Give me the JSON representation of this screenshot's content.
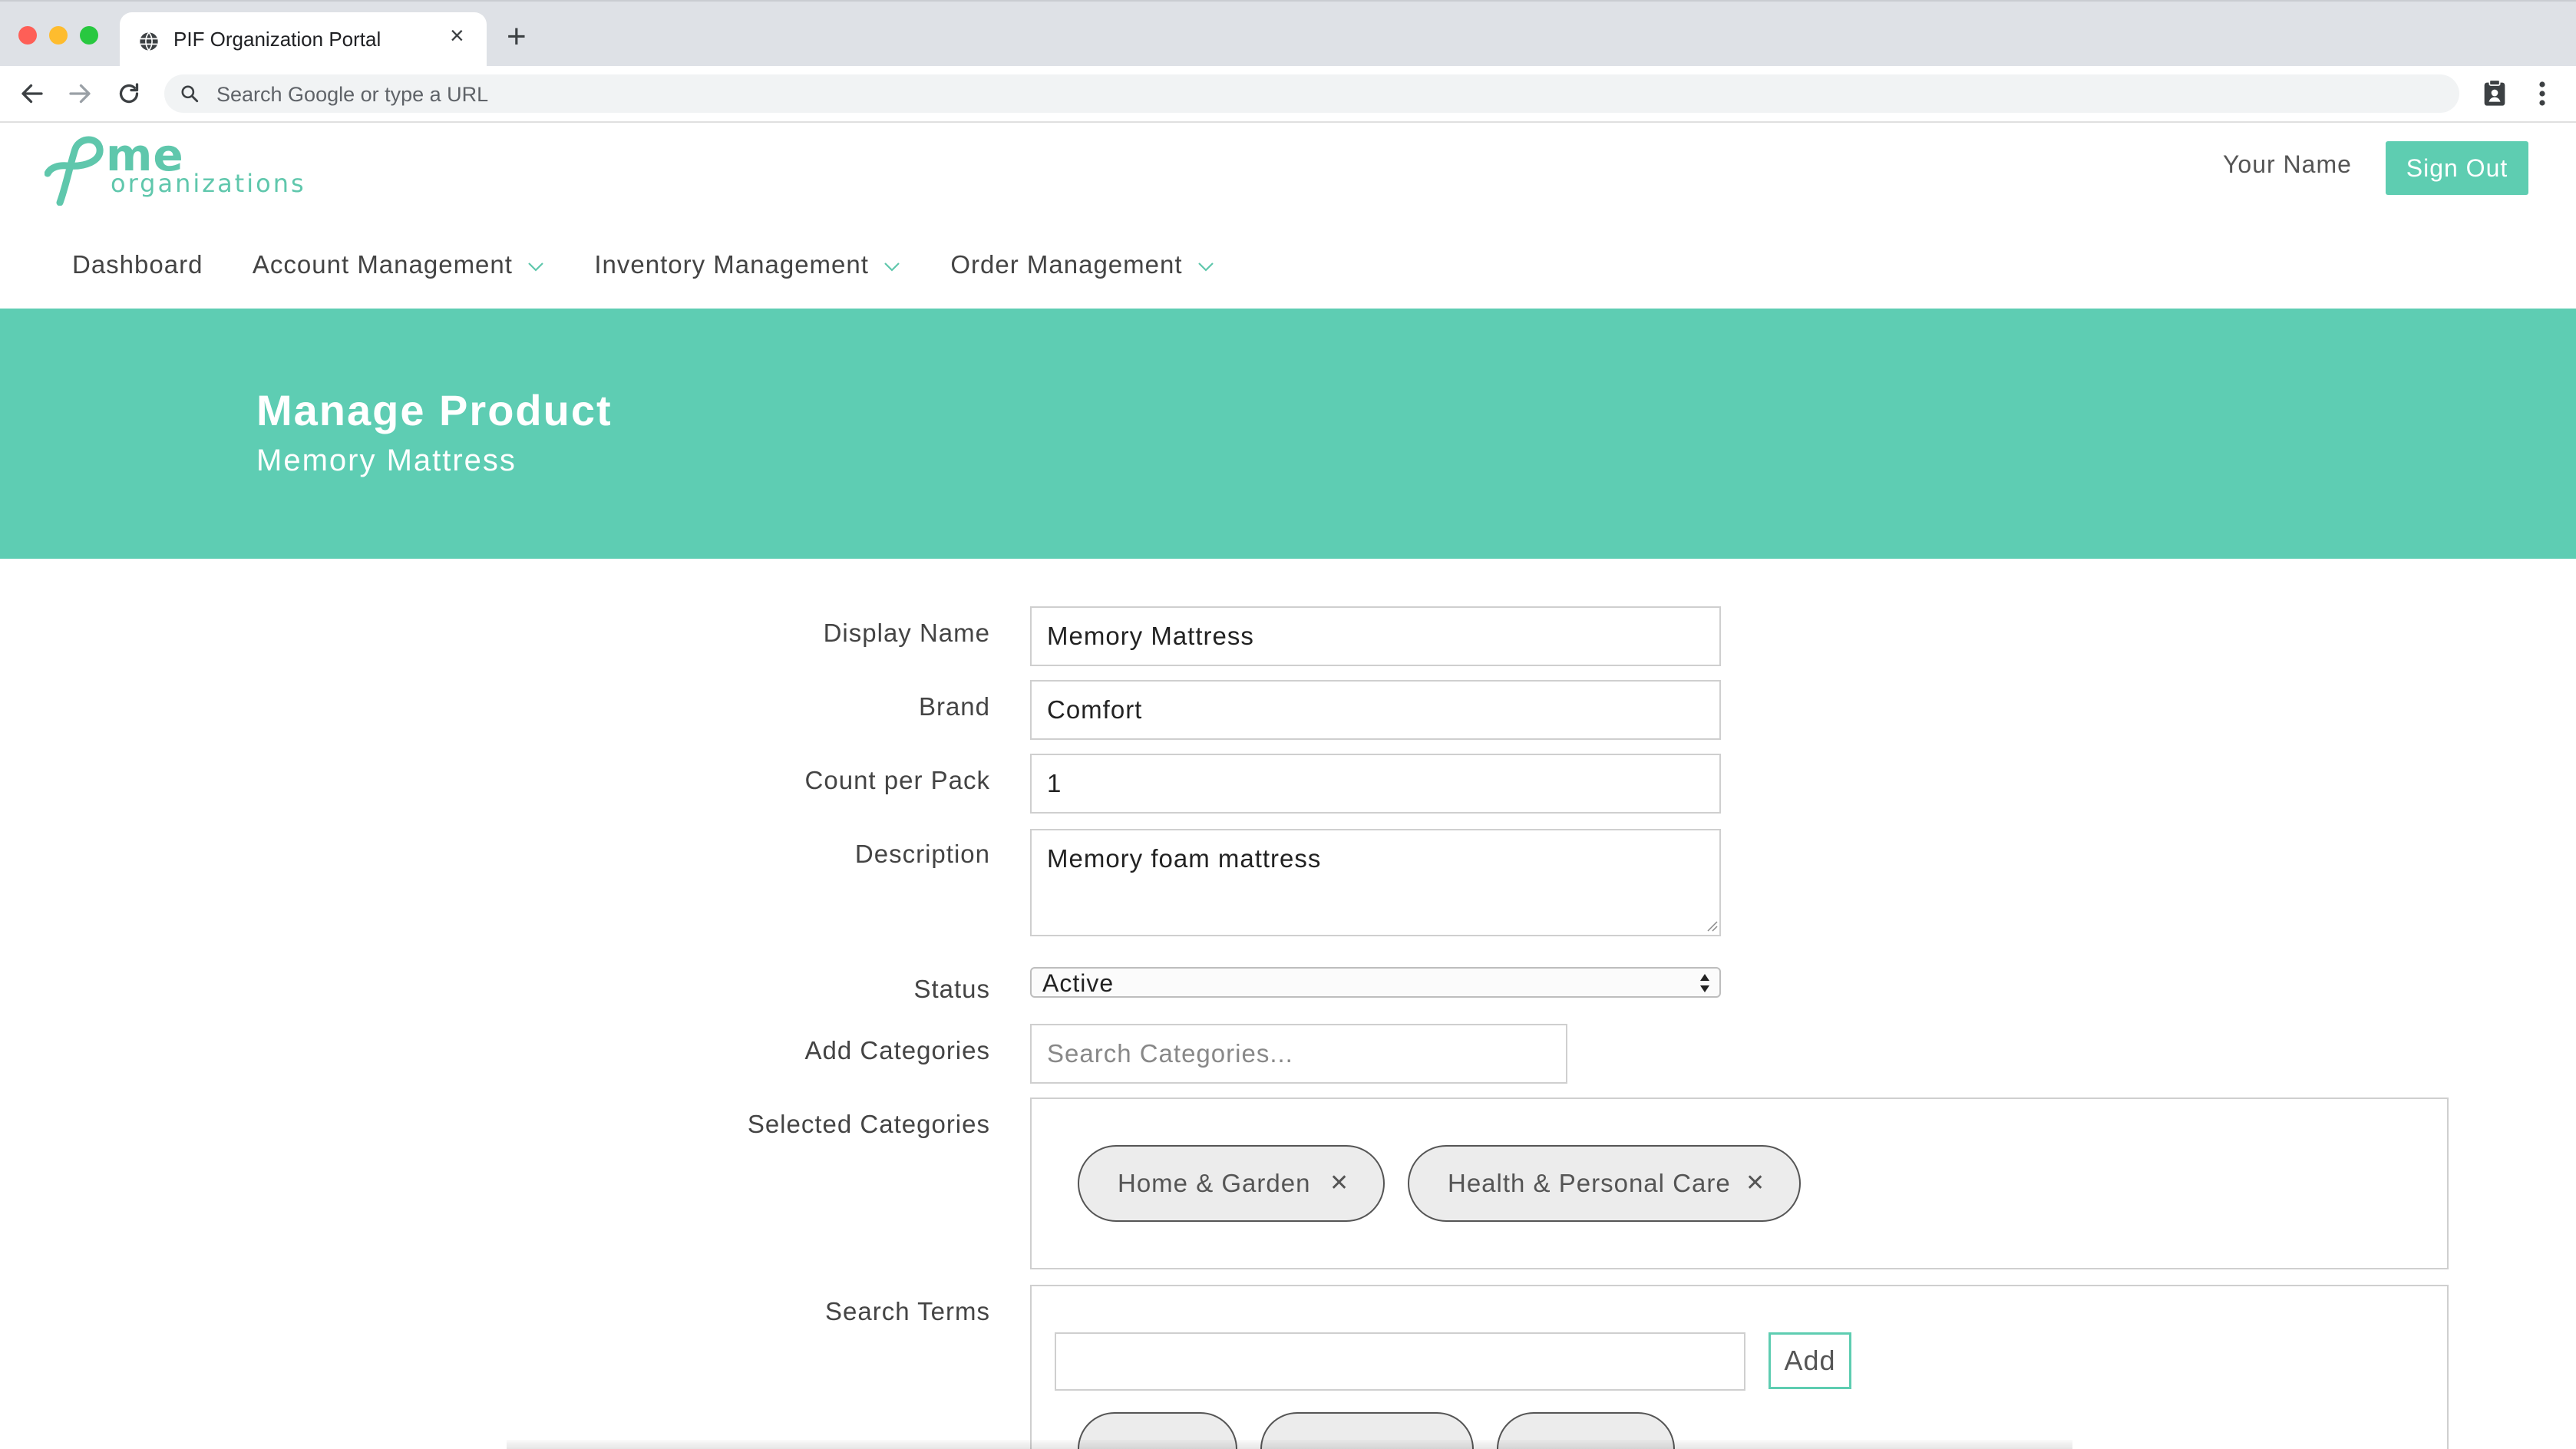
{
  "browser": {
    "tab_title": "PIF Organization Portal",
    "omnibox_placeholder": "Search Google or type a URL",
    "traffic_colors": {
      "close": "#fe5f57",
      "minimize": "#febc2e",
      "zoom": "#28c840"
    }
  },
  "header": {
    "logo_primary": "me",
    "logo_secondary": "organizations",
    "user_name": "Your Name",
    "sign_out_label": "Sign Out",
    "accent_color": "#5ecdb1"
  },
  "nav": {
    "items": [
      {
        "label": "Dashboard",
        "has_dropdown": false
      },
      {
        "label": "Account Management",
        "has_dropdown": true
      },
      {
        "label": "Inventory Management",
        "has_dropdown": true
      },
      {
        "label": "Order Management",
        "has_dropdown": true
      }
    ]
  },
  "banner": {
    "title": "Manage Product",
    "subtitle": "Memory Mattress",
    "color": "#5ecdb3"
  },
  "form": {
    "display_name": {
      "label": "Display Name",
      "value": "Memory Mattress"
    },
    "brand": {
      "label": "Brand",
      "value": "Comfort"
    },
    "count_per_pack": {
      "label": "Count per Pack",
      "value": "1"
    },
    "description": {
      "label": "Description",
      "value": "Memory foam mattress"
    },
    "status": {
      "label": "Status",
      "value": "Active"
    },
    "add_categories": {
      "label": "Add Categories",
      "placeholder": "Search Categories..."
    },
    "selected_categories": {
      "label": "Selected Categories",
      "items": [
        "Home & Garden",
        "Health & Personal Care"
      ]
    },
    "search_terms": {
      "label": "Search Terms",
      "input_value": "",
      "add_label": "Add"
    }
  }
}
